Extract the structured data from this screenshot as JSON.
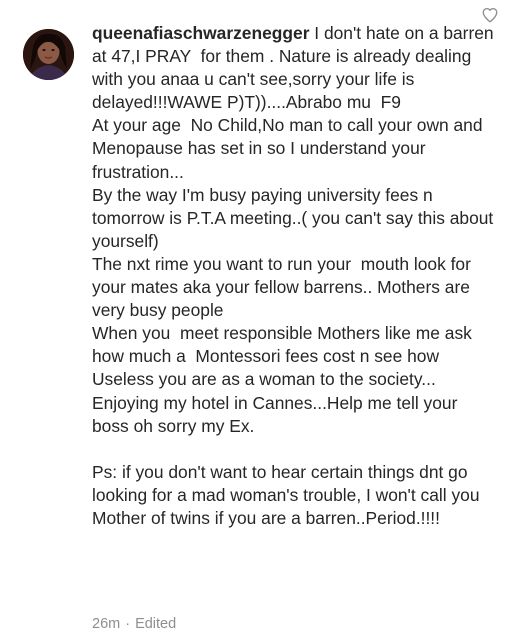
{
  "comment": {
    "username": "queenafiaschwarzenegger",
    "body": " I don't hate on a barren at 47,I PRAY  for them . Nature is already dealing with you anaa u can't see,sorry your life is delayed!!!WAWE P)T))....Abrabo mu  F9\nAt your age  No Child,No man to call your own and Menopause has set in so I understand your frustration...\nBy the way I'm busy paying university fees n tomorrow is P.T.A meeting..( you can't say this about yourself)\nThe nxt rime you want to run your  mouth look for your mates aka your fellow barrens.. Mothers are very busy people\nWhen you  meet responsible Mothers like me ask how much a  Montessori fees cost n see how Useless you are as a woman to the society...\nEnjoying my hotel in Cannes...Help me tell your boss oh sorry my Ex.\n\nPs: if you don't want to hear certain things dnt go looking for a mad woman's trouble, I won't call you Mother of twins if you are a barren..Period.!!!!",
    "time": "26m",
    "separator": "·",
    "edited": "Edited"
  },
  "icons": {
    "avatar": "profile-avatar",
    "like": "heart-icon"
  }
}
